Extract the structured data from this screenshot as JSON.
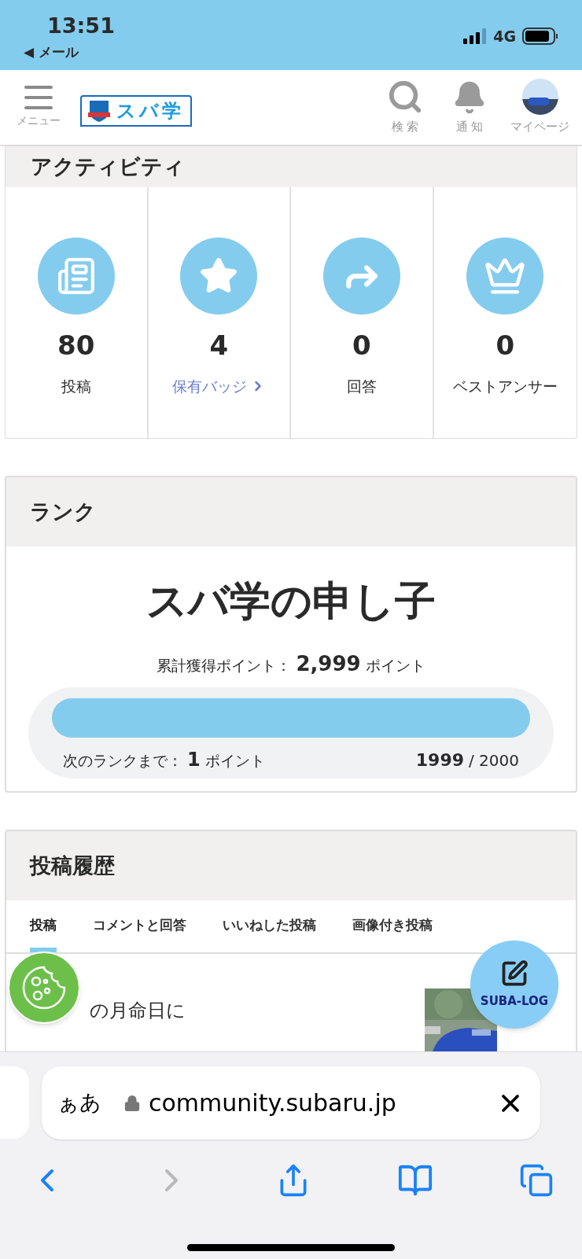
{
  "status_bar": {
    "time": "13:51",
    "back_app": "◀ メール",
    "network": "4G"
  },
  "header": {
    "menu_label": "メニュー",
    "logo_text": "スバ学",
    "actions": [
      {
        "kind": "search",
        "label": "検 索"
      },
      {
        "kind": "bell",
        "label": "通 知"
      },
      {
        "kind": "avatar",
        "label": "マイページ"
      }
    ]
  },
  "activity": {
    "title": "アクティビティ",
    "stats": [
      {
        "kind": "posts",
        "value": "80",
        "label": "投稿",
        "link": false
      },
      {
        "kind": "badges",
        "value": "4",
        "label": "保有バッジ",
        "link": true
      },
      {
        "kind": "answers",
        "value": "0",
        "label": "回答",
        "link": false
      },
      {
        "kind": "best",
        "value": "0",
        "label": "ベストアンサー",
        "link": false
      }
    ]
  },
  "rank": {
    "title": "ランク",
    "rank_name": "スバ学の申し子",
    "total_label": "累計獲得ポイント：",
    "total_value": "2,999",
    "total_unit": "ポイント",
    "level": 0.9995,
    "next_label": "次のランクまで：",
    "next_value": "1",
    "next_unit": "ポイント",
    "current": "1999",
    "max": "/ 2000"
  },
  "history": {
    "title": "投稿履歴",
    "tabs": [
      {
        "label": "投稿",
        "selected": true
      },
      {
        "label": "コメントと回答",
        "selected": false
      },
      {
        "label": "いいねした投稿",
        "selected": false
      },
      {
        "label": "画像付き投稿",
        "selected": false
      }
    ],
    "post": {
      "title": "の月命日に"
    }
  },
  "fab": {
    "label": "SUBA-LOG"
  },
  "browser": {
    "text_size": "ぁあ",
    "url": "community.subaru.jp"
  }
}
